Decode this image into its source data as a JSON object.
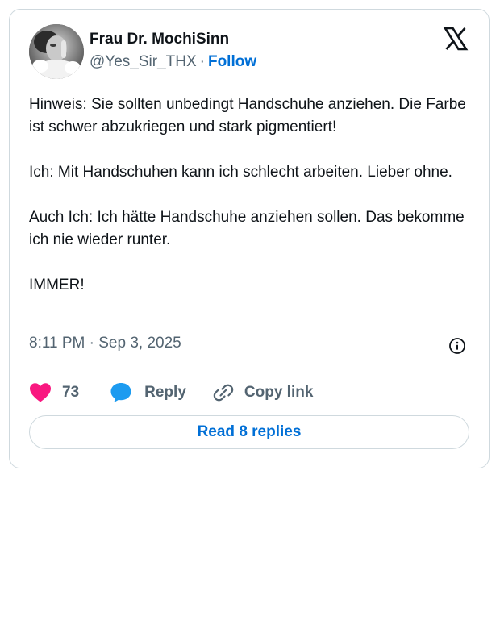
{
  "author": {
    "name": "Frau Dr. MochiSinn",
    "handle": "@Yes_Sir_THX",
    "separator": "·",
    "follow_label": "Follow"
  },
  "icons": {
    "logo": "x-logo-icon",
    "info": "info-icon",
    "like": "heart-icon",
    "reply": "speech-bubble-icon",
    "copy": "link-icon"
  },
  "tweet": {
    "paragraphs": [
      "Hinweis: Sie sollten unbedingt Handschuhe anziehen. Die Farbe ist schwer abzukriegen und stark pigmentiert!",
      "Ich: Mit Handschuhen kann ich schlecht arbeiten. Lieber ohne.",
      "Auch Ich: Ich hätte Handschuhe anziehen sollen. Das bekomme ich nie wieder runter.",
      "IMMER!"
    ],
    "timestamp": "8:11 PM · Sep 3, 2025"
  },
  "actions": {
    "like_count": "73",
    "reply_label": "Reply",
    "copy_label": "Copy link"
  },
  "read_replies_label": "Read 8 replies",
  "colors": {
    "accent": "#006fd6",
    "like": "#f91880",
    "reply": "#1d9bf0",
    "text": "#0f1419",
    "muted": "#536471",
    "border": "#cfd9de"
  }
}
